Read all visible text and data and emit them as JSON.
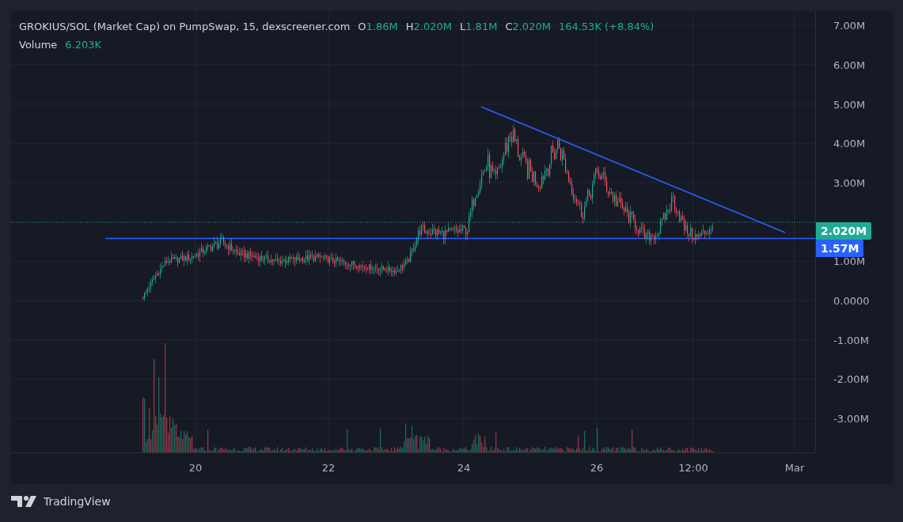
{
  "legend": {
    "title": "GROKIUS/SOL (Market Cap) on PumpSwap, 15, dexscreener.com",
    "ohlc": [
      {
        "label": "O",
        "value": "1.86M"
      },
      {
        "label": "H",
        "value": "2.020M"
      },
      {
        "label": "L",
        "value": "1.81M"
      },
      {
        "label": "C",
        "value": "2.020M"
      }
    ],
    "change": "164.53K (+8.84%)",
    "volume": {
      "label": "Volume",
      "value": "6.203K"
    }
  },
  "price_axis": {
    "ticks": [
      "7.00M",
      "6.00M",
      "5.00M",
      "4.00M",
      "3.00M",
      "1.00M",
      "0.0000",
      "-1.00M",
      "-2.00M",
      "-3.00M"
    ],
    "labels": [
      {
        "text": "2.020M",
        "kind": "last"
      },
      {
        "text": "1.57M",
        "kind": "line"
      }
    ]
  },
  "time_axis": {
    "ticks": [
      "20",
      "22",
      "24",
      "26",
      "12:00",
      "Mar"
    ]
  },
  "footer": {
    "brand": "TradingView"
  }
}
